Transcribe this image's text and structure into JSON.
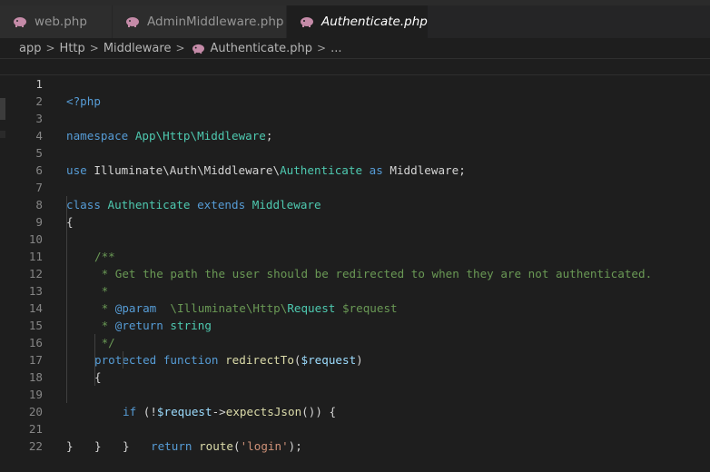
{
  "tabs": [
    {
      "label": "web.php",
      "icon": "php-elephant-icon"
    },
    {
      "label": "AdminMiddleware.php",
      "icon": "php-elephant-icon"
    },
    {
      "label": "Authenticate.php",
      "icon": "php-elephant-icon",
      "active": true,
      "close": "✕"
    }
  ],
  "breadcrumb": {
    "parts": [
      "app",
      "Http",
      "Middleware",
      "Authenticate.php",
      "..."
    ]
  },
  "editor": {
    "line_numbers": [
      "1",
      "2",
      "3",
      "4",
      "5",
      "6",
      "7",
      "8",
      "9",
      "10",
      "11",
      "12",
      "13",
      "14",
      "15",
      "16",
      "17",
      "18",
      "19",
      "20",
      "21",
      "22"
    ],
    "code": {
      "l1": "<?php",
      "l3a": "namespace",
      "l3b": " App\\Http\\Middleware",
      "l3c": ";",
      "l5a": "use",
      "l5b": " Illuminate\\Auth\\Middleware\\",
      "l5c": "Authenticate",
      "l5d": " as",
      "l5e": " Middleware;",
      "l7a": "class",
      "l7b": " Authenticate",
      "l7c": " extends",
      "l7d": " Middleware",
      "l8": "{",
      "l9": "/**",
      "l10": " * Get the path the user should be redirected to when they are not authenticated.",
      "l11": " *",
      "l12a": " * ",
      "l12b": "@param",
      "l12c": "  \\Illuminate\\Http\\",
      "l12d": "Request",
      "l12e": " $request",
      "l13a": " * ",
      "l13b": "@return",
      "l13c": " string",
      "l14": " */",
      "l15a": "protected",
      "l15b": " function",
      "l15c": " redirectTo",
      "l15d": "(",
      "l15e": "$request",
      "l15f": ")",
      "l16": "{",
      "l17a": "if",
      "l17b": " (!",
      "l17c": "$request",
      "l17d": "->",
      "l17e": "expectsJson",
      "l17f": "()) {",
      "l18a": "return",
      "l18b": " route",
      "l18c": "(",
      "l18d": "'login'",
      "l18e": ");",
      "l19": "}",
      "l20": "}",
      "l21": "}"
    }
  }
}
